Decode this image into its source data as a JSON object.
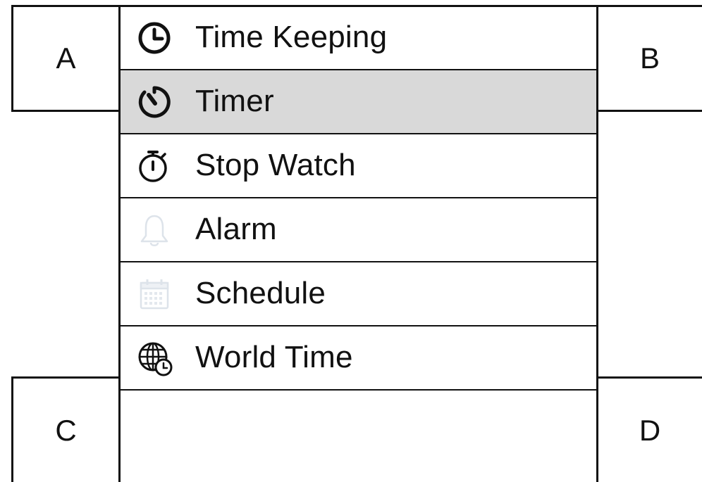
{
  "corners": {
    "a_label": "A",
    "b_label": "B",
    "c_label": "C",
    "d_label": "D"
  },
  "menu": {
    "selected_index": 1,
    "items": [
      {
        "label": "Time Keeping",
        "icon": "clock-icon",
        "enabled": true
      },
      {
        "label": "Timer",
        "icon": "timer-icon",
        "enabled": true
      },
      {
        "label": "Stop Watch",
        "icon": "stopwatch-icon",
        "enabled": true
      },
      {
        "label": "Alarm",
        "icon": "bell-icon",
        "enabled": false
      },
      {
        "label": "Schedule",
        "icon": "calendar-icon",
        "enabled": false
      },
      {
        "label": "World Time",
        "icon": "globe-clock-icon",
        "enabled": true
      }
    ]
  },
  "colors": {
    "selected_bg": "#d9d9d9",
    "disabled_icon": "#dde3ea",
    "foreground": "#111111"
  }
}
